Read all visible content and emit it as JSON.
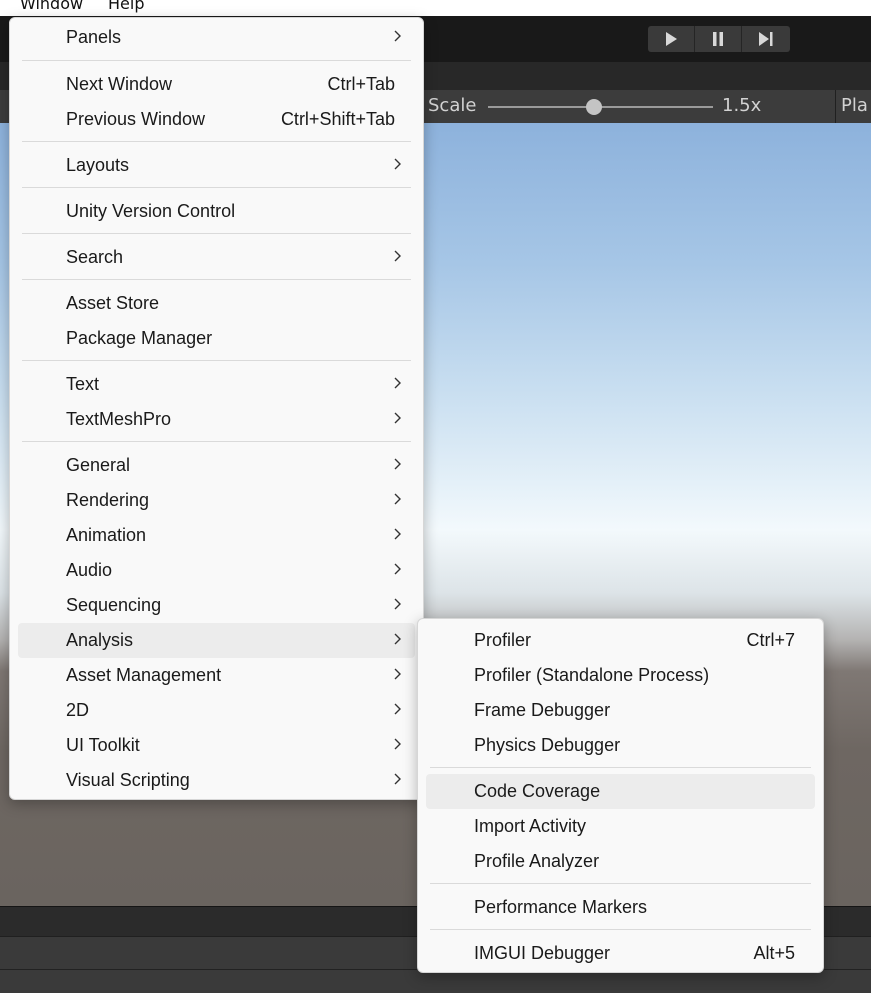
{
  "menubar": {
    "window": "Window",
    "help": "Help"
  },
  "toolbar": {
    "play_icon": "play-icon",
    "pause_icon": "pause-icon",
    "step_icon": "step-icon"
  },
  "game_view": {
    "scale_label": "Scale",
    "scale_value": "1.5x",
    "scale_fraction": 0.47,
    "play_label": "Pla"
  },
  "window_menu": {
    "items": [
      {
        "label": "Panels",
        "submenu": true
      },
      {
        "label": "Next Window",
        "shortcut": "Ctrl+Tab"
      },
      {
        "label": "Previous Window",
        "shortcut": "Ctrl+Shift+Tab"
      },
      {
        "label": "Layouts",
        "submenu": true
      },
      {
        "label": "Unity Version Control"
      },
      {
        "label": "Search",
        "submenu": true
      },
      {
        "label": "Asset Store"
      },
      {
        "label": "Package Manager"
      },
      {
        "label": "Text",
        "submenu": true
      },
      {
        "label": "TextMeshPro",
        "submenu": true
      },
      {
        "label": "General",
        "submenu": true
      },
      {
        "label": "Rendering",
        "submenu": true
      },
      {
        "label": "Animation",
        "submenu": true
      },
      {
        "label": "Audio",
        "submenu": true
      },
      {
        "label": "Sequencing",
        "submenu": true
      },
      {
        "label": "Analysis",
        "submenu": true,
        "highlighted": true
      },
      {
        "label": "Asset Management",
        "submenu": true
      },
      {
        "label": "2D",
        "submenu": true
      },
      {
        "label": "UI Toolkit",
        "submenu": true
      },
      {
        "label": "Visual Scripting",
        "submenu": true
      }
    ]
  },
  "analysis_menu": {
    "items": [
      {
        "label": "Profiler",
        "shortcut": "Ctrl+7"
      },
      {
        "label": "Profiler (Standalone Process)"
      },
      {
        "label": "Frame Debugger"
      },
      {
        "label": "Physics Debugger"
      },
      {
        "label": "Code Coverage",
        "highlighted": true
      },
      {
        "label": "Import Activity"
      },
      {
        "label": "Profile Analyzer"
      },
      {
        "label": "Performance Markers"
      },
      {
        "label": "IMGUI Debugger",
        "shortcut": "Alt+5"
      }
    ]
  }
}
